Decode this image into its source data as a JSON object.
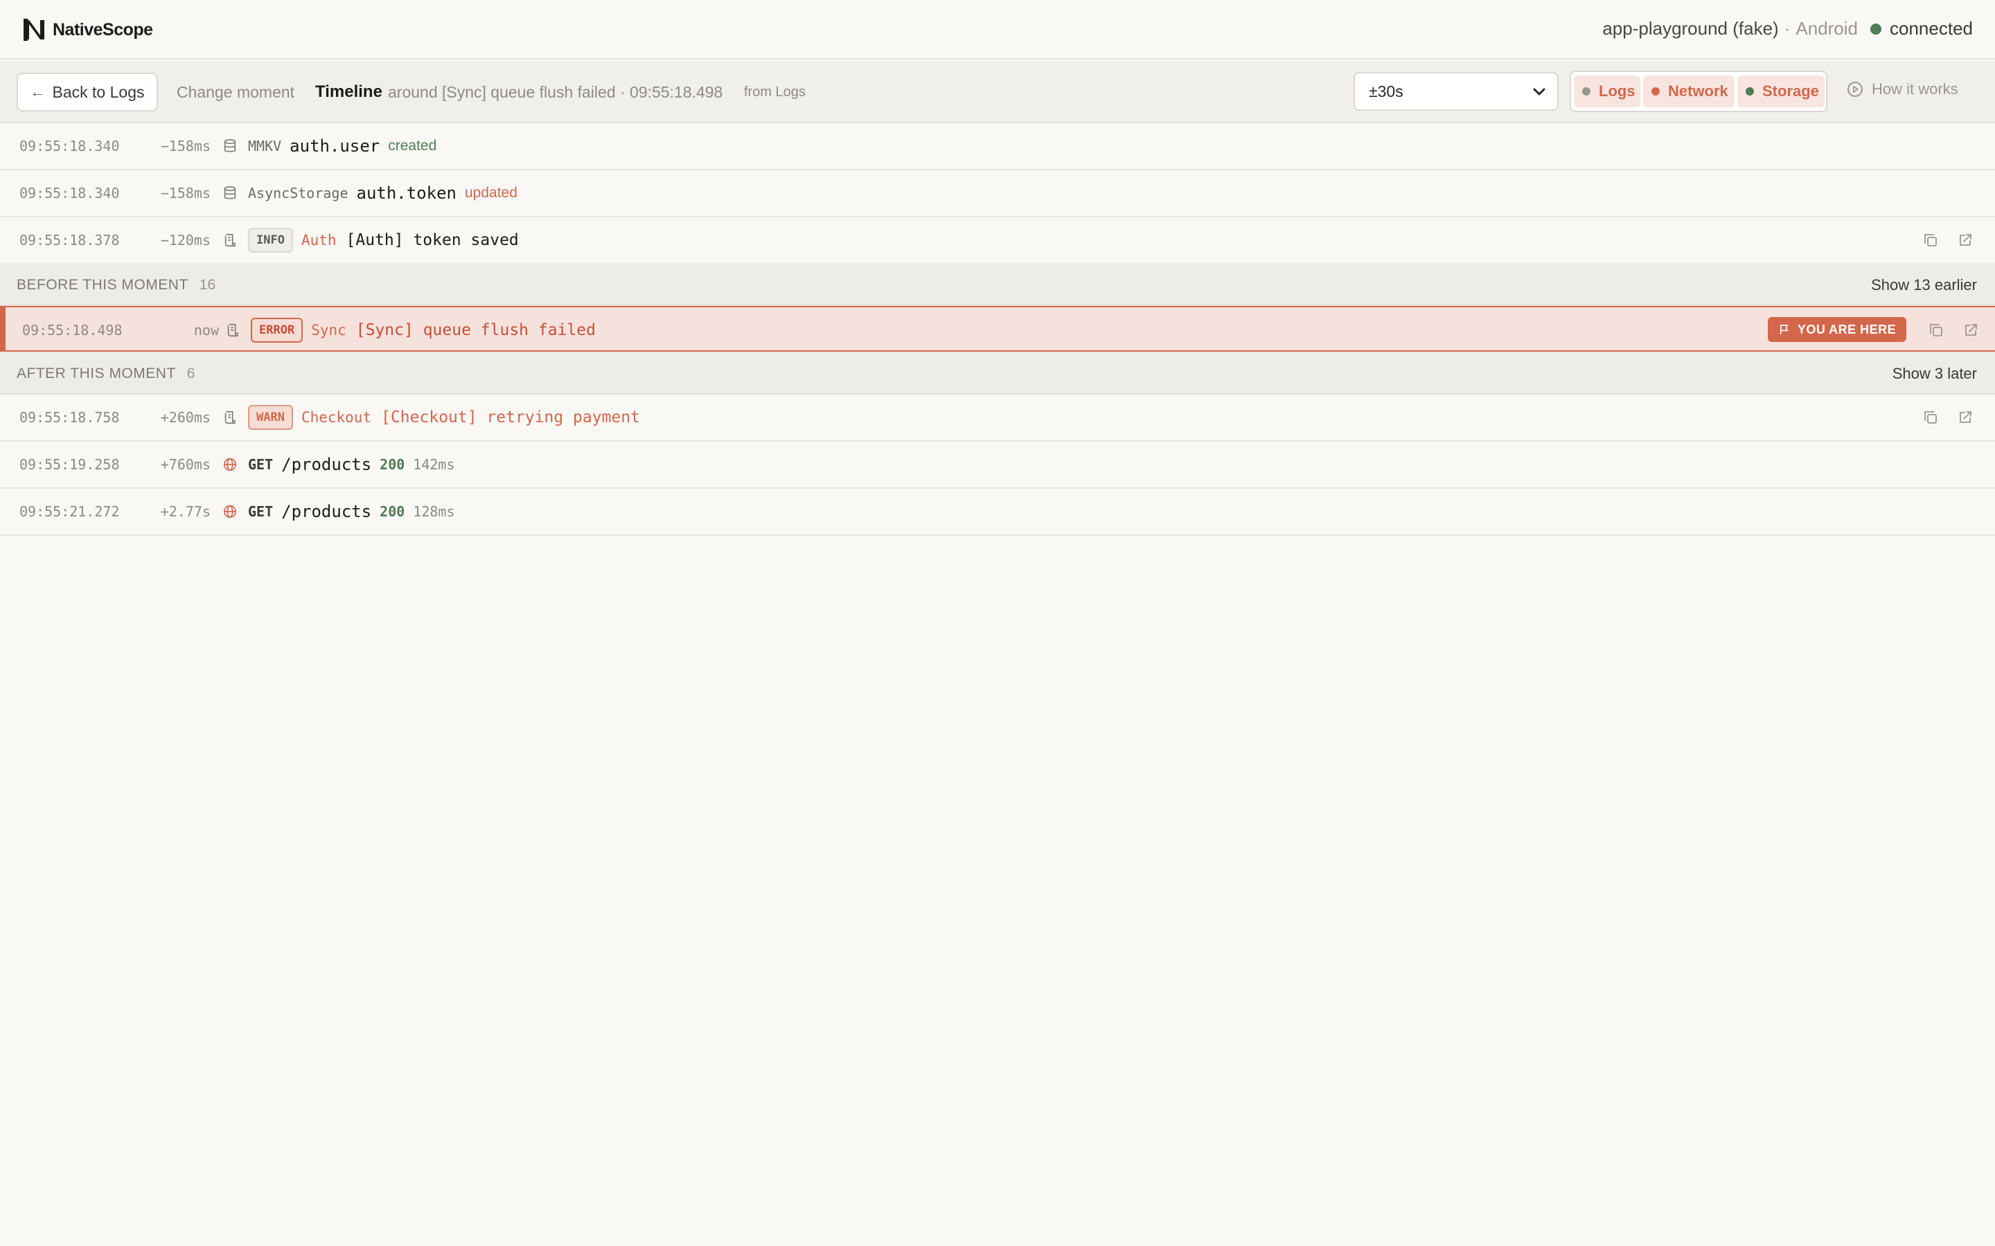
{
  "header": {
    "app_name": "NativeScope",
    "app_id": "app-playground (fake)",
    "separator": "·",
    "platform": "Android",
    "connection_status": "connected",
    "status_color": "#4e7d57"
  },
  "toolbar": {
    "back_label": "Back to Logs",
    "change_moment_label": "Change moment",
    "timeline_title": "Timeline",
    "timeline_desc": "around [Sync] queue flush failed · 09:55:18.498",
    "timeline_source": "from Logs",
    "range_value": "±30s",
    "filters": [
      {
        "label": "Logs",
        "dot_color": "#9a968f"
      },
      {
        "label": "Network",
        "dot_color": "#d2674b"
      },
      {
        "label": "Storage",
        "dot_color": "#4e7d57"
      }
    ],
    "how_label": "How it works"
  },
  "rows_before": [
    {
      "time": "09:55:18.340",
      "delta": "−158ms",
      "icon": "database-icon",
      "store": "MMKV",
      "key": "auth.user",
      "action": "created"
    },
    {
      "time": "09:55:18.340",
      "delta": "−158ms",
      "icon": "database-icon",
      "store": "AsyncStorage",
      "key": "auth.token",
      "action": "updated"
    },
    {
      "time": "09:55:18.378",
      "delta": "−120ms",
      "icon": "log-icon",
      "level": "INFO",
      "tag": "Auth",
      "message": "[Auth] token saved"
    }
  ],
  "section_before": {
    "title": "BEFORE THIS MOMENT",
    "count": "16",
    "more": "Show 13 earlier"
  },
  "current": {
    "time": "09:55:18.498",
    "delta": "now",
    "icon": "log-icon",
    "level": "ERROR",
    "tag": "Sync",
    "message": "[Sync] queue flush failed",
    "marker": "YOU ARE HERE"
  },
  "section_after": {
    "title": "AFTER THIS MOMENT",
    "count": "6",
    "more": "Show 3 later"
  },
  "rows_after": [
    {
      "time": "09:55:18.758",
      "delta": "+260ms",
      "icon": "log-icon",
      "level": "WARN",
      "tag": "Checkout",
      "message": "[Checkout] retrying payment"
    },
    {
      "time": "09:55:19.258",
      "delta": "+760ms",
      "icon": "globe-icon",
      "method": "GET",
      "path": "/products",
      "status": "200",
      "duration": "142ms"
    },
    {
      "time": "09:55:21.272",
      "delta": "+2.77s",
      "icon": "globe-icon",
      "method": "GET",
      "path": "/products",
      "status": "200",
      "duration": "128ms"
    }
  ],
  "colors": {
    "accent": "#d2674b",
    "success": "#4e7d57",
    "background": "#f9f8f5"
  }
}
